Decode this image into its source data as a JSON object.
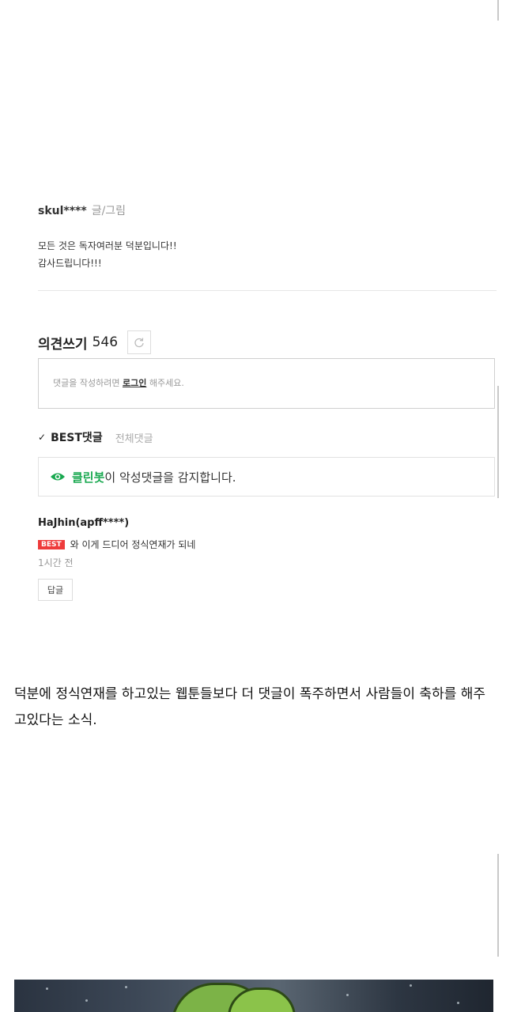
{
  "author": {
    "name": "skul****",
    "role": "글/그림"
  },
  "author_message": [
    "모든 것은 독자여러분 덕분입니다!!",
    "감사드립니다!!!"
  ],
  "comments": {
    "header_label": "의견쓰기",
    "count": "546",
    "refresh_icon": "refresh-icon",
    "input_placeholder_pre": "댓글을 작성하려면",
    "input_login_link": "로그인",
    "input_placeholder_post": "해주세요.",
    "tab_best": "BEST댓글",
    "tab_all": "전체댓글",
    "cleanbot_brand": "클린봇",
    "cleanbot_text": "이 악성댓글을 감지합니다.",
    "items": [
      {
        "user": "HaJhin(apff****)",
        "badge": "BEST",
        "text": "와 이게 드디어 정식연재가 되네",
        "time": "1시간 전",
        "reply_label": "답글"
      }
    ]
  },
  "body_text": "덕분에 정식연재를 하고있는 웹툰들보다 더 댓글이 폭주하면서 사람들이 축하를 해주고있다는 소식.",
  "colors": {
    "cleanbot_green": "#18a84f",
    "best_badge_red": "#ee3b3b"
  }
}
